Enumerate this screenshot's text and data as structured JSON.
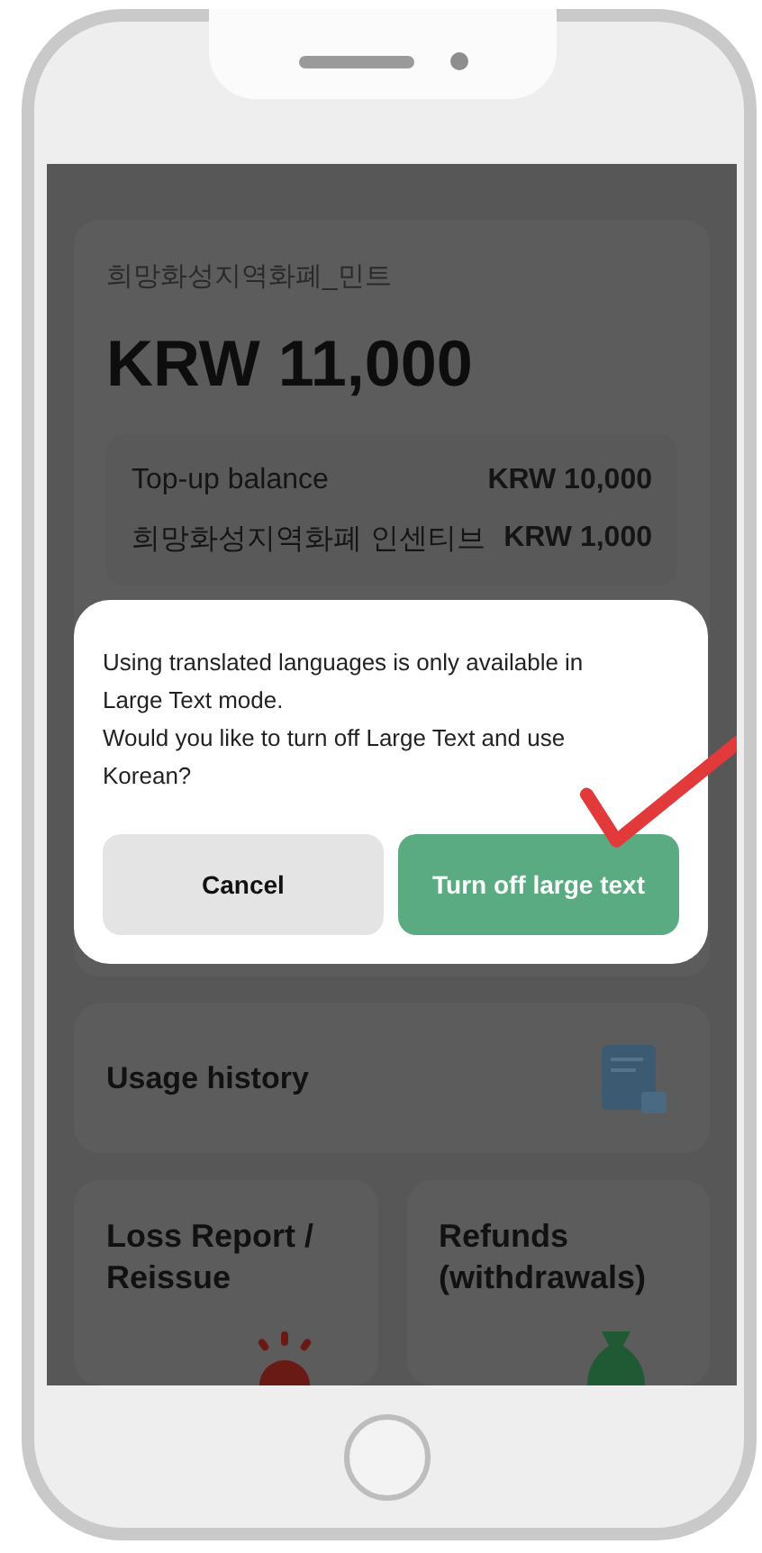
{
  "wallet_card": {
    "title": "희망화성지역화폐_민트",
    "amount": "KRW 11,000",
    "breakdown": [
      {
        "label": "Top-up balance",
        "value": "KRW 10,000"
      },
      {
        "label": "희망화성지역화폐 인센티브",
        "value": "KRW 1,000"
      }
    ]
  },
  "menu": [
    {
      "kind": "wide",
      "label": "Usage history"
    },
    {
      "kind": "half",
      "label": "Loss Report / Reissue"
    },
    {
      "kind": "half",
      "label": "Refunds (withdrawals)"
    }
  ],
  "dialog": {
    "messages": [
      "Using translated languages is only available in Large Text mode.",
      "Would you like to turn off Large Text and use Korean?"
    ],
    "buttons": [
      {
        "kind": "secondary",
        "label": "Cancel"
      },
      {
        "kind": "primary",
        "label": "Turn off large text"
      }
    ]
  }
}
